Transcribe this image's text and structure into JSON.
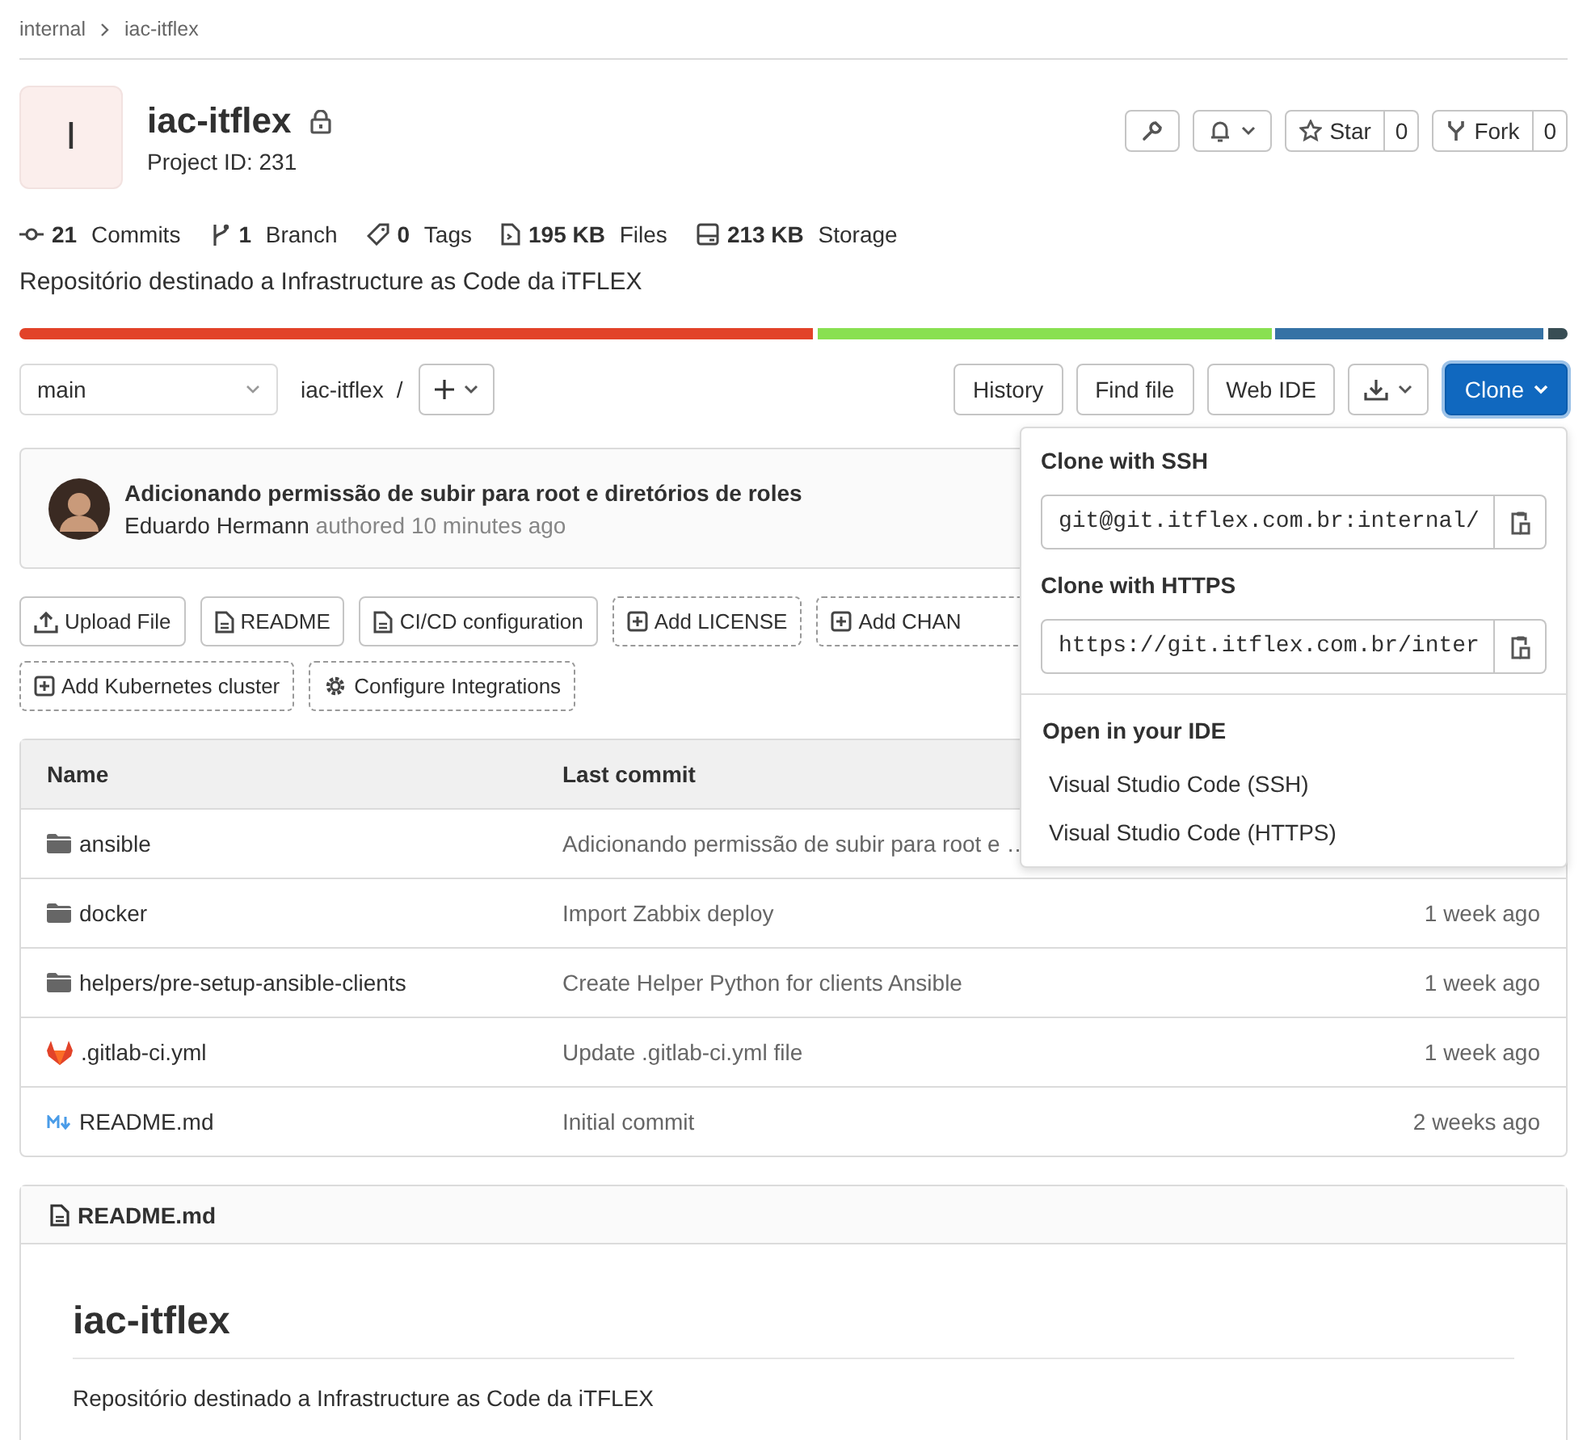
{
  "breadcrumb": [
    {
      "label": "internal"
    },
    {
      "label": "iac-itflex"
    }
  ],
  "project": {
    "avatar_letter": "I",
    "name": "iac-itflex",
    "private": true,
    "project_id": "Project ID: 231"
  },
  "actions": {
    "star": {
      "label": "Star",
      "count": "0"
    },
    "fork": {
      "label": "Fork",
      "count": "0"
    }
  },
  "stats": [
    {
      "kind": "commits",
      "value": "21",
      "label": "Commits"
    },
    {
      "kind": "branch",
      "value": "1",
      "label": "Branch"
    },
    {
      "kind": "tags",
      "value": "0",
      "label": "Tags"
    },
    {
      "kind": "files",
      "value": "195 KB",
      "label": "Files"
    },
    {
      "kind": "storage",
      "value": "213 KB",
      "label": "Storage"
    }
  ],
  "description": "Repositório destinado a Infrastructure as Code da iTFLEX",
  "toolbar": {
    "branch": "main",
    "path": "iac-itflex",
    "separator": "/",
    "buttons": [
      "History",
      "Find file",
      "Web IDE"
    ],
    "clone": "Clone"
  },
  "last_commit": {
    "title": "Adicionando permissão de subir para root e diretórios de roles",
    "author": "Eduardo Hermann",
    "action": "authored",
    "time": "10 minutes ago"
  },
  "quick_actions": [
    {
      "label": "Upload File",
      "kind": "upload",
      "dashed": false
    },
    {
      "label": "README",
      "kind": "doc",
      "dashed": false
    },
    {
      "label": "CI/CD configuration",
      "kind": "doc",
      "dashed": false
    },
    {
      "label": "Add LICENSE",
      "kind": "add",
      "dashed": true
    },
    {
      "label": "Add CHAN",
      "kind": "add",
      "dashed": true
    },
    {
      "label": "Add Kubernetes cluster",
      "kind": "add",
      "dashed": true
    },
    {
      "label": "Configure Integrations",
      "kind": "gear",
      "dashed": true
    }
  ],
  "files": {
    "columns": [
      "Name",
      "Last commit"
    ],
    "rows": [
      {
        "kind": "folder",
        "name": "ansible",
        "commit": "Adicionando permissão de subir para root e …"
      },
      {
        "kind": "folder",
        "name": "docker",
        "commit": "Import Zabbix deploy",
        "updated": "1 week ago"
      },
      {
        "kind": "folder",
        "name": "helpers/pre-setup-ansible-clients",
        "commit": "Create Helper Python for clients Ansible",
        "updated": "1 week ago"
      },
      {
        "kind": "gitlab",
        "name": ".gitlab-ci.yml",
        "commit": "Update .gitlab-ci.yml file",
        "updated": "1 week ago"
      },
      {
        "kind": "markdown",
        "name": "README.md",
        "commit": "Initial commit",
        "updated": "2 weeks ago"
      }
    ]
  },
  "clone_dropdown": {
    "ssh": {
      "heading": "Clone with SSH",
      "value": "git@git.itflex.com.br:internal/"
    },
    "https": {
      "heading": "Clone with HTTPS",
      "value": "https://git.itflex.com.br/inter"
    },
    "ide_heading": "Open in your IDE",
    "ide_options": [
      "Visual Studio Code (SSH)",
      "Visual Studio Code (HTTPS)"
    ]
  },
  "readme": {
    "filename": "README.md",
    "heading": "iac-itflex",
    "text": "Repositório destinado a Infrastructure as Code da iTFLEX"
  }
}
